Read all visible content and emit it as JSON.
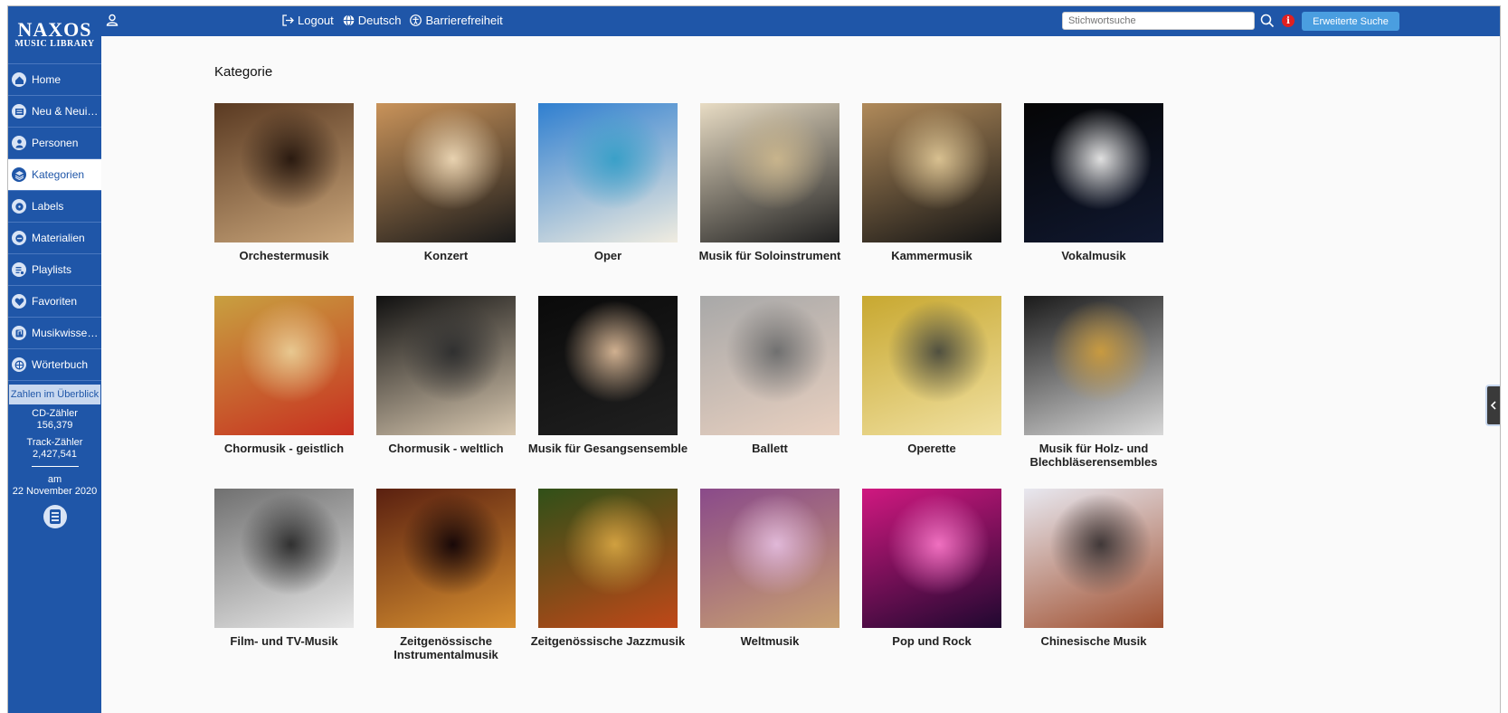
{
  "sidebar": {
    "logo_main": "NAXOS",
    "logo_sub": "MUSIC LIBRARY",
    "items": [
      {
        "label": "Home",
        "icon": "home-icon"
      },
      {
        "label": "Neu & Neuigkeiten",
        "icon": "news-icon"
      },
      {
        "label": "Personen",
        "icon": "person-icon"
      },
      {
        "label": "Kategorien",
        "icon": "layers-icon",
        "active": true
      },
      {
        "label": "Labels",
        "icon": "label-icon"
      },
      {
        "label": "Materialien",
        "icon": "material-icon"
      },
      {
        "label": "Playlists",
        "icon": "playlist-icon"
      },
      {
        "label": "Favoriten",
        "icon": "heart-icon"
      },
      {
        "label": "Musikwissenschaft",
        "icon": "music-knowledge-icon"
      },
      {
        "label": "Wörterbuch",
        "icon": "dictionary-icon"
      }
    ],
    "stats_button": "Zahlen im Überblick",
    "cd_label": "CD-Zähler",
    "cd_value": "156,379",
    "track_label": "Track-Zähler",
    "track_value": "2,427,541",
    "date_prefix": "am",
    "date_value": "22 November 2020"
  },
  "topbar": {
    "logout": "Logout",
    "language": "Deutsch",
    "accessibility": "Barrierefreiheit",
    "search_placeholder": "Stichwortsuche",
    "advanced_search": "Erweiterte Suche",
    "info_glyph": "i"
  },
  "main": {
    "title": "Kategorie",
    "categories": [
      {
        "label": "Orchestermusik",
        "colors": [
          "#5a3a22",
          "#c9a57a",
          "#2a1a10"
        ]
      },
      {
        "label": "Konzert",
        "colors": [
          "#c9935a",
          "#1a1a1a",
          "#e8d2b0"
        ]
      },
      {
        "label": "Oper",
        "colors": [
          "#2f7fd0",
          "#f0ece0",
          "#3aa0c8"
        ]
      },
      {
        "label": "Musik für Soloinstrument",
        "colors": [
          "#e8dcc4",
          "#202020",
          "#c8b48c"
        ]
      },
      {
        "label": "Kammermusik",
        "colors": [
          "#b08a5a",
          "#151515",
          "#d8c090"
        ]
      },
      {
        "label": "Vokalmusik",
        "colors": [
          "#050505",
          "#101830",
          "#e0e0e0"
        ]
      },
      {
        "label": "Chormusik - geistlich",
        "colors": [
          "#c8a040",
          "#c83020",
          "#e8c890"
        ]
      },
      {
        "label": "Chormusik - weltlich",
        "colors": [
          "#101010",
          "#d8c8b0",
          "#303030"
        ]
      },
      {
        "label": "Musik für Gesangsensemble",
        "colors": [
          "#0a0a0a",
          "#202020",
          "#d0b090"
        ]
      },
      {
        "label": "Ballett",
        "colors": [
          "#a8a8a8",
          "#e8d0c0",
          "#707070"
        ]
      },
      {
        "label": "Operette",
        "colors": [
          "#c8a830",
          "#f0e0a0",
          "#505040"
        ]
      },
      {
        "label": "Musik für Holz- und Blechbläserensembles",
        "colors": [
          "#1a1a1a",
          "#d8d8d8",
          "#c89a40"
        ]
      },
      {
        "label": "Film- und TV-Musik",
        "colors": [
          "#707070",
          "#e8e8e8",
          "#303030"
        ]
      },
      {
        "label": "Zeitgenössische Instrumentalmusik",
        "colors": [
          "#5a2010",
          "#d89030",
          "#180808"
        ]
      },
      {
        "label": "Zeitgenössische Jazzmusik",
        "colors": [
          "#305018",
          "#c04818",
          "#d0a040"
        ]
      },
      {
        "label": "Weltmusik",
        "colors": [
          "#8a4a8a",
          "#c8a070",
          "#e0b8d8"
        ]
      },
      {
        "label": "Pop und Rock",
        "colors": [
          "#d01880",
          "#200830",
          "#f070c0"
        ]
      },
      {
        "label": "Chinesische Musik",
        "colors": [
          "#e8e8f0",
          "#a05030",
          "#403838"
        ]
      }
    ]
  }
}
